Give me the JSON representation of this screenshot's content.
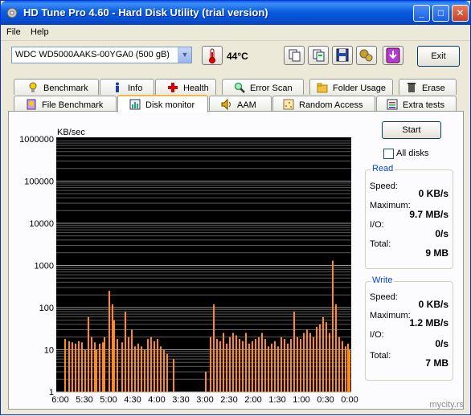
{
  "window": {
    "title": "HD Tune Pro 4.60 - Hard Disk Utility (trial version)",
    "buttons": {
      "minimize": "_",
      "maximize": "□",
      "close": "✕"
    }
  },
  "menu": {
    "file": "File",
    "help": "Help"
  },
  "toolbar": {
    "drive": "WDC WD5000AAKS-00YGA0 (500 gB)",
    "temperature": "44°C",
    "exit": "Exit",
    "icons": [
      "copy-icon",
      "copy-all-icon",
      "save-icon",
      "options-icon",
      "download-icon"
    ]
  },
  "tabs_top": [
    {
      "label": "Benchmark",
      "icon": "bulb-icon"
    },
    {
      "label": "Info",
      "icon": "info-icon"
    },
    {
      "label": "Health",
      "icon": "health-cross-icon"
    },
    {
      "label": "Error Scan",
      "icon": "magnifier-icon"
    },
    {
      "label": "Folder Usage",
      "icon": "folder-icon"
    },
    {
      "label": "Erase",
      "icon": "trash-icon"
    }
  ],
  "tabs_bottom": [
    {
      "label": "File Benchmark",
      "icon": "file-bulb-icon"
    },
    {
      "label": "Disk monitor",
      "icon": "bar-chart-icon",
      "active": true
    },
    {
      "label": "AAM",
      "icon": "speaker-icon"
    },
    {
      "label": "Random Access",
      "icon": "grid-icon"
    },
    {
      "label": "Extra tests",
      "icon": "tests-icon"
    }
  ],
  "controls": {
    "start": "Start",
    "all_disks": "All disks",
    "all_disks_checked": false
  },
  "read": {
    "title": "Read",
    "speed_label": "Speed:",
    "speed": "0 KB/s",
    "max_label": "Maximum:",
    "max": "9.7 MB/s",
    "io_label": "I/O:",
    "io": "0/s",
    "total_label": "Total:",
    "total": "9 MB"
  },
  "write": {
    "title": "Write",
    "speed_label": "Speed:",
    "speed": "0 KB/s",
    "max_label": "Maximum:",
    "max": "1.2 MB/s",
    "io_label": "I/O:",
    "io": "0/s",
    "total_label": "Total:",
    "total": "7 MB"
  },
  "watermark": "mycity.rs",
  "colors": {
    "bar": "#ff8c1a",
    "chart_bg": "#000000",
    "grid": "#808080",
    "group_title": "#0046d5"
  },
  "chart_data": {
    "type": "bar",
    "ylabel": "KB/sec",
    "yscale": "log",
    "ylim": [
      1,
      1000000
    ],
    "yticks": [
      "1000000",
      "100000",
      "10000",
      "1000",
      "100",
      "10",
      "1"
    ],
    "xticks": [
      "6:00",
      "5:30",
      "5:00",
      "4:30",
      "4:00",
      "3:30",
      "3:00",
      "2:30",
      "2:00",
      "1:30",
      "1:00",
      "0:30",
      "0:00"
    ],
    "x_unit": "min:sec ago",
    "values": [
      [
        355,
        18
      ],
      [
        350,
        16
      ],
      [
        346,
        15
      ],
      [
        342,
        14
      ],
      [
        338,
        16
      ],
      [
        334,
        15
      ],
      [
        330,
        10
      ],
      [
        326,
        60
      ],
      [
        322,
        20
      ],
      [
        318,
        15
      ],
      [
        316,
        10
      ],
      [
        312,
        14
      ],
      [
        308,
        15
      ],
      [
        306,
        20
      ],
      [
        300,
        250
      ],
      [
        296,
        120
      ],
      [
        294,
        50
      ],
      [
        290,
        18
      ],
      [
        284,
        15
      ],
      [
        280,
        80
      ],
      [
        276,
        20
      ],
      [
        272,
        30
      ],
      [
        268,
        12
      ],
      [
        264,
        14
      ],
      [
        260,
        12
      ],
      [
        256,
        10
      ],
      [
        252,
        18
      ],
      [
        248,
        20
      ],
      [
        244,
        16
      ],
      [
        240,
        18
      ],
      [
        236,
        12
      ],
      [
        232,
        10
      ],
      [
        228,
        8
      ],
      [
        220,
        6
      ],
      [
        180,
        3
      ],
      [
        174,
        20
      ],
      [
        170,
        120
      ],
      [
        166,
        18
      ],
      [
        162,
        16
      ],
      [
        158,
        25
      ],
      [
        154,
        14
      ],
      [
        150,
        20
      ],
      [
        146,
        25
      ],
      [
        142,
        22
      ],
      [
        138,
        18
      ],
      [
        134,
        16
      ],
      [
        130,
        25
      ],
      [
        126,
        14
      ],
      [
        122,
        16
      ],
      [
        118,
        18
      ],
      [
        114,
        20
      ],
      [
        110,
        25
      ],
      [
        106,
        18
      ],
      [
        102,
        12
      ],
      [
        98,
        14
      ],
      [
        94,
        16
      ],
      [
        90,
        12
      ],
      [
        86,
        20
      ],
      [
        82,
        18
      ],
      [
        78,
        14
      ],
      [
        74,
        18
      ],
      [
        70,
        80
      ],
      [
        66,
        20
      ],
      [
        62,
        18
      ],
      [
        58,
        25
      ],
      [
        54,
        30
      ],
      [
        50,
        25
      ],
      [
        46,
        20
      ],
      [
        42,
        35
      ],
      [
        38,
        40
      ],
      [
        34,
        60
      ],
      [
        30,
        45
      ],
      [
        26,
        25
      ],
      [
        22,
        1300
      ],
      [
        18,
        120
      ],
      [
        14,
        20
      ],
      [
        10,
        16
      ],
      [
        6,
        12
      ],
      [
        3,
        14
      ],
      [
        1,
        10
      ]
    ]
  }
}
